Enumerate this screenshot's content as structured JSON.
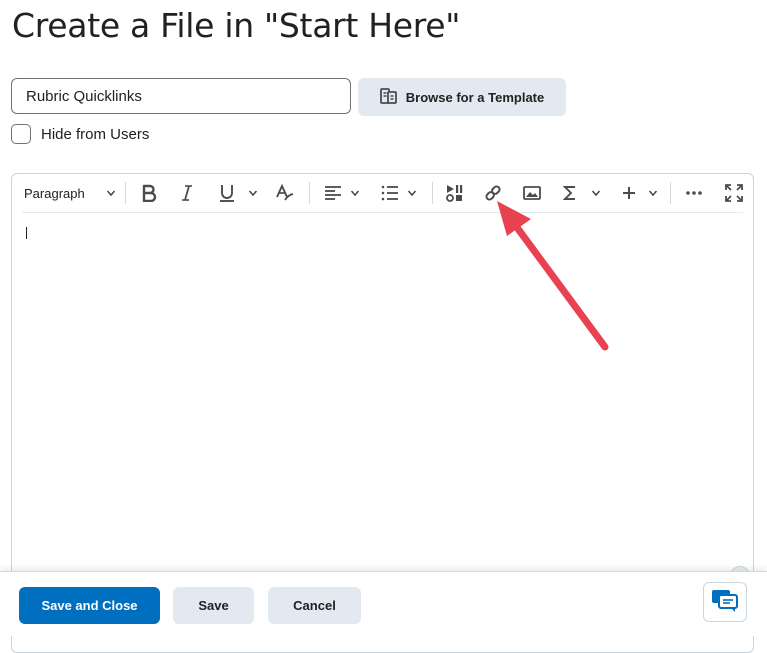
{
  "page": {
    "title": "Create a File in \"Start Here\""
  },
  "form": {
    "title_value": "Rubric Quicklinks",
    "browse_template_label": "Browse for a Template",
    "hide_from_users_label": "Hide from Users",
    "hide_from_users_checked": false
  },
  "toolbar": {
    "paragraph_label": "Paragraph",
    "buttons": [
      "bold-icon",
      "italic-icon",
      "underline-icon",
      "format-icon",
      "align-icon",
      "list-icon",
      "media-icon",
      "link-icon",
      "image-icon",
      "equation-icon",
      "insert-icon",
      "more-icon",
      "fullscreen-icon"
    ]
  },
  "footer": {
    "save_close_label": "Save and Close",
    "save_label": "Save",
    "cancel_label": "Cancel"
  },
  "colors": {
    "primary": "#006fbf",
    "secondary_button": "#e3e9f1",
    "annotation_arrow": "#e8414f"
  }
}
